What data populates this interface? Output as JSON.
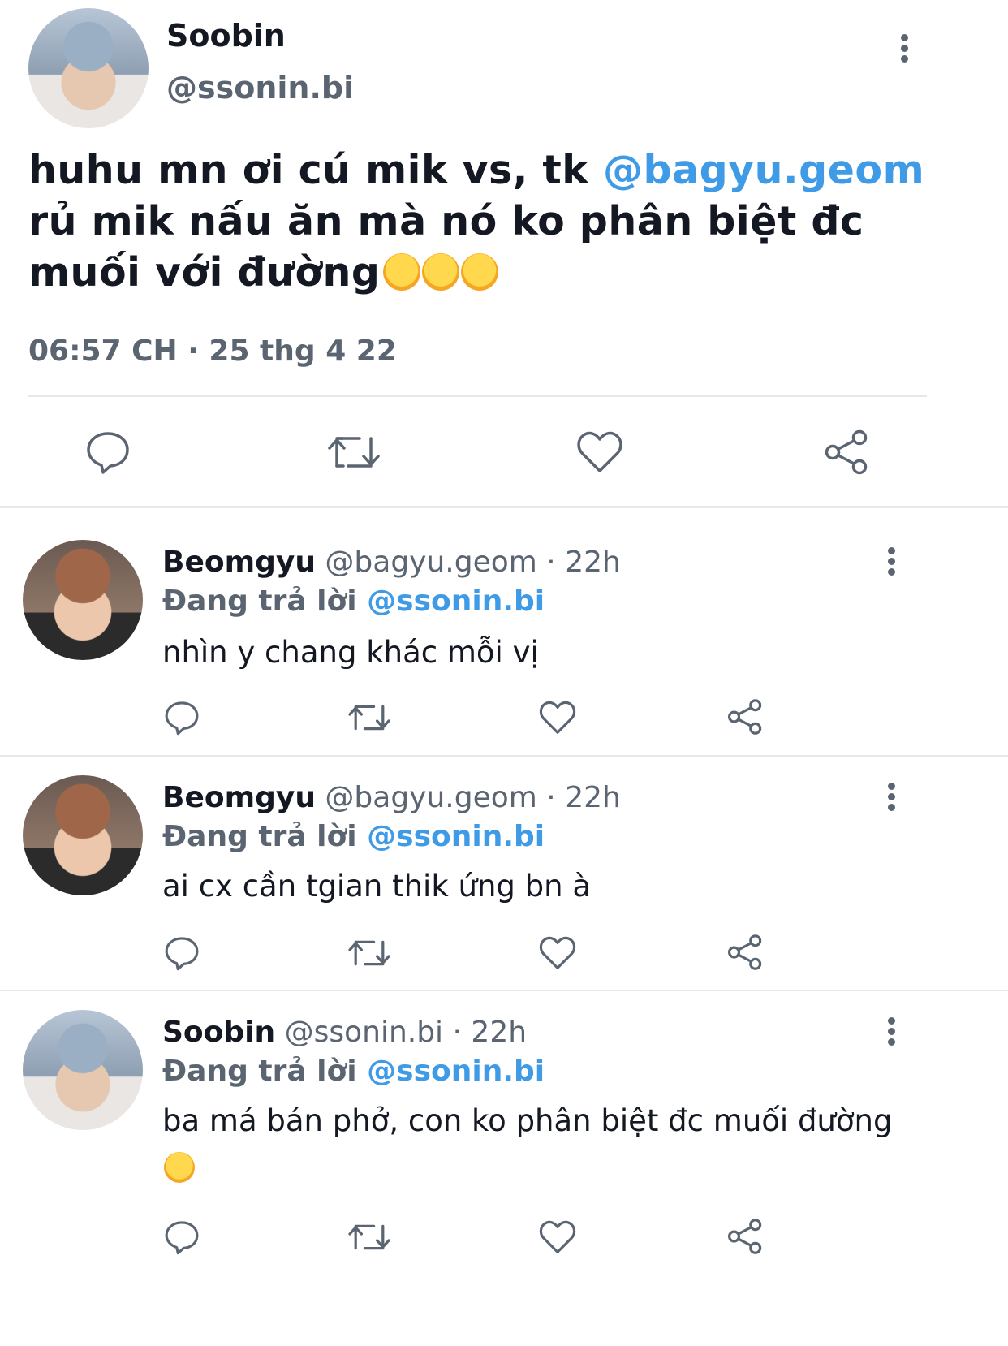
{
  "tweet": {
    "author_name": "Soobin",
    "author_handle": "@ssonin.bi",
    "text_before": "huhu mn ơi cú mik vs, tk ",
    "mention": "@bagyu.geom",
    "text_after": " rủ mik nấu ăn mà nó ko phân biệt đc muối với đường",
    "emojis": "😭😭😭",
    "timestamp": "06:57 CH · 25 thg 4 22"
  },
  "actions": {
    "reply_icon": "reply-icon",
    "retweet_icon": "retweet-icon",
    "like_icon": "heart-icon",
    "share_icon": "share-icon"
  },
  "replies": [
    {
      "name": "Beomgyu",
      "handle": "@bagyu.geom",
      "time": "22h",
      "replying_label": "Đang trả lời",
      "replying_to": "@ssonin.bi",
      "text": "nhìn y chang khác mỗi vị",
      "emoji": ""
    },
    {
      "name": "Beomgyu",
      "handle": "@bagyu.geom",
      "time": "22h",
      "replying_label": "Đang trả lời",
      "replying_to": "@ssonin.bi",
      "text": "ai cx cần tgian thik ứng bn à",
      "emoji": ""
    },
    {
      "name": "Soobin",
      "handle": "@ssonin.bi",
      "time": "22h",
      "replying_label": "Đang trả lời",
      "replying_to": "@ssonin.bi",
      "text": "ba má bán phở, con ko phân biệt đc muối đường",
      "emoji": "🤣"
    }
  ],
  "colors": {
    "mention": "#3f9be6",
    "secondary_text": "#5b6572",
    "icon": "#5b6572",
    "divider": "#e6e8ec"
  }
}
